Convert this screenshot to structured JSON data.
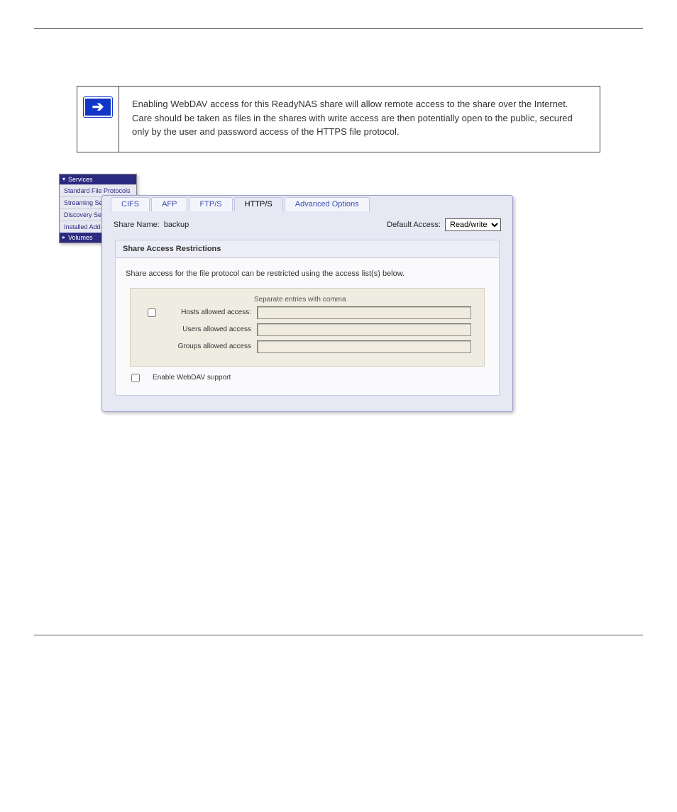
{
  "note": {
    "text": "Enabling WebDAV access for this ReadyNAS share will allow remote access to the share over the Internet. Care should be taken as files in the shares with write access are then potentially open to the public, secured only by the user and password access of the HTTPS file protocol."
  },
  "sidebar": {
    "header": "Services",
    "items": [
      "Standard File Protocols",
      "Streaming Ser",
      "Discovery Serv",
      "Installed Add-"
    ],
    "selected": "Volumes"
  },
  "tabs": [
    "CIFS",
    "AFP",
    "FTP/S",
    "HTTP/S",
    "Advanced Options"
  ],
  "active_tab_index": 3,
  "share": {
    "name_label": "Share Name:",
    "name_value": "backup",
    "default_access_label": "Default Access:",
    "default_access_value": "Read/write"
  },
  "section": {
    "title": "Share Access Restrictions",
    "desc": "Share access for the file protocol can be restricted using the access list(s) below.",
    "hint": "Separate entries with comma",
    "rows": [
      {
        "checkbox": true,
        "label": "Hosts allowed access:",
        "value": ""
      },
      {
        "checkbox": false,
        "label": "Users allowed access",
        "value": ""
      },
      {
        "checkbox": false,
        "label": "Groups allowed access",
        "value": ""
      }
    ],
    "webdav_label": "Enable WebDAV support"
  }
}
